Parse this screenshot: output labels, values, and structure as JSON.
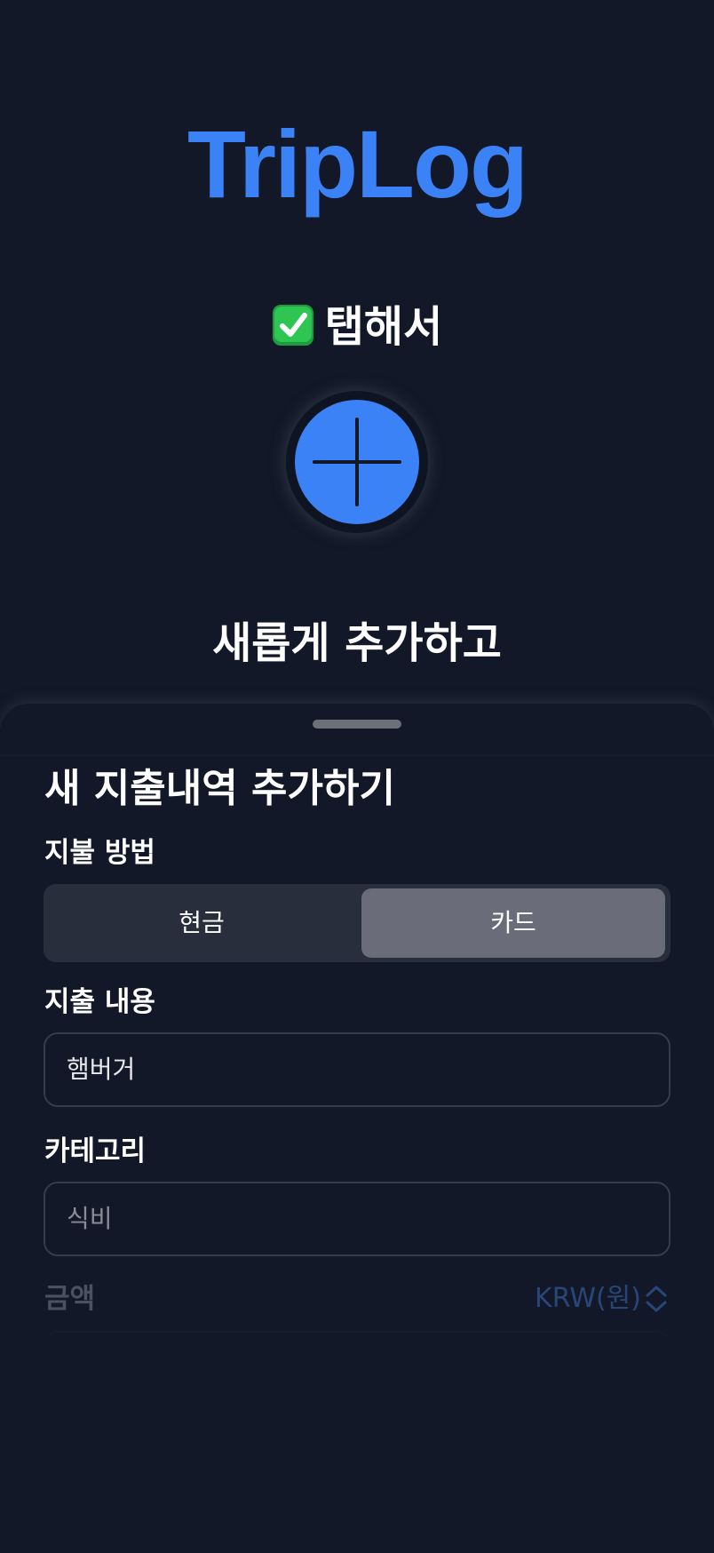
{
  "app": {
    "title": "TripLog"
  },
  "hero": {
    "step_icon": "check-mark-button-icon",
    "step_label": "탭해서",
    "add_icon": "plus-icon",
    "tagline": "새롭게 추가하고"
  },
  "sheet": {
    "title": "새 지출내역 추가하기",
    "payment": {
      "label": "지불 방법",
      "options": [
        "현금",
        "카드"
      ],
      "selected": "카드"
    },
    "description": {
      "label": "지출 내용",
      "value": "햄버거"
    },
    "category": {
      "label": "카테고리",
      "placeholder": "식비"
    },
    "amount": {
      "label": "금액",
      "currency": "KRW(원)",
      "currency_icon": "chevron-up-down-icon"
    }
  },
  "colors": {
    "background": "#121827",
    "accent": "#3b82f6",
    "segment_bg": "#282e3c",
    "segment_selected": "#6a6d79",
    "check_green": "#22c55e"
  }
}
